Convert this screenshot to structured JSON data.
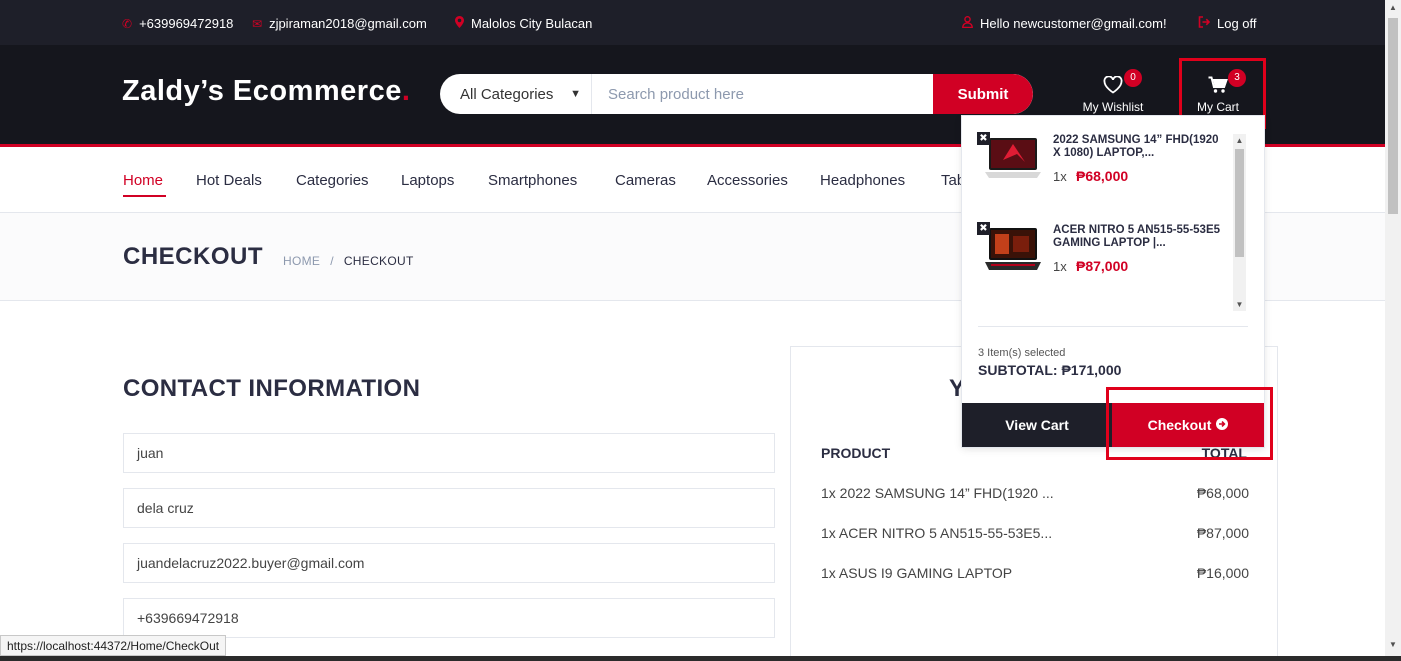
{
  "topbar": {
    "phone": "+639969472918",
    "email": "zjpiraman2018@gmail.com",
    "location": "Malolos City Bulacan",
    "greeting": "Hello newcustomer@gmail.com!",
    "logout": "Log off",
    "icons": [
      "phone-icon",
      "envelope-icon",
      "map-marker-icon",
      "user-icon",
      "sign-out-icon"
    ]
  },
  "header": {
    "logo": "Zaldy’s Ecommerce",
    "logo_dot": ".",
    "category_select": "All Categories",
    "search_placeholder": "Search product here",
    "submit": "Submit",
    "wishlist": {
      "label": "My Wishlist",
      "count": "0"
    },
    "cart": {
      "label": "My Cart",
      "count": "3"
    }
  },
  "nav": {
    "links": [
      "Home",
      "Hot Deals",
      "Categories",
      "Laptops",
      "Smartphones",
      "Cameras",
      "Accessories",
      "Headphones",
      "Tab"
    ],
    "active": "Home"
  },
  "breadcrumb": {
    "title": "CHECKOUT",
    "home": "HOME",
    "separator": "/",
    "current": "CHECKOUT"
  },
  "contact": {
    "title": "CONTACT INFORMATION",
    "fields": [
      "juan",
      "dela cruz",
      "juandelacruz2022.buyer@gmail.com",
      "+639669472918"
    ]
  },
  "order": {
    "title_visible": "Y",
    "col_product": "PRODUCT",
    "col_total": "TOTAL",
    "rows": [
      {
        "product": "1x 2022 SAMSUNG 14” FHD(1920 ...",
        "total": "₱68,000"
      },
      {
        "product": "1x ACER NITRO 5 AN515-55-53E5...",
        "total": "₱87,000"
      },
      {
        "product": "1x ASUS I9 GAMING LAPTOP",
        "total": "₱16,000"
      }
    ]
  },
  "cart_dropdown": {
    "items": [
      {
        "name": "2022 SAMSUNG 14” FHD(1920 X 1080) LAPTOP,...",
        "qty": "1x",
        "price": "₱68,000"
      },
      {
        "name": "ACER NITRO 5 AN515-55-53E5 GAMING LAPTOP |...",
        "qty": "1x",
        "price": "₱87,000"
      }
    ],
    "selected": "3 Item(s) selected",
    "subtotal": "SUBTOTAL: ₱171,000",
    "view_cart": "View Cart",
    "checkout": "Checkout"
  },
  "status_url": "https://localhost:44372/Home/CheckOut",
  "colors": {
    "accent": "#d10024",
    "dark": "#15161d",
    "topbar": "#1e1f29",
    "highlight_box": "#e0001b"
  }
}
